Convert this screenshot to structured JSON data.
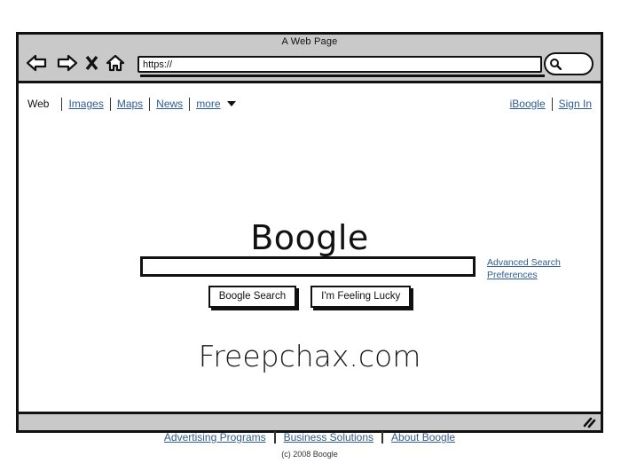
{
  "window": {
    "title": "A Web Page",
    "url_value": "https://",
    "url_placeholder": "https://",
    "toolbar_search_value": "",
    "icons": {
      "back": "back-arrow-icon",
      "forward": "forward-arrow-icon",
      "stop": "stop-x-icon",
      "home": "home-icon",
      "search": "magnifier-icon",
      "resize": "resize-grip-icon"
    }
  },
  "topnav": {
    "current": "Web",
    "links": [
      "Images",
      "Maps",
      "News",
      "more"
    ],
    "account_links": [
      "iBoogle",
      "Sign In"
    ]
  },
  "main": {
    "logo": "Boogle",
    "search_value": "",
    "search_placeholder": "",
    "side_links": [
      "Advanced Search",
      "Preferences"
    ],
    "buttons": [
      "Boogle Search",
      "I'm Feeling Lucky"
    ],
    "tagline": "Freepchax.com"
  },
  "footer": {
    "links": [
      "Advertising Programs",
      "Business Solutions",
      "About Boogle"
    ],
    "copyright": "(c) 2008 Boogle"
  },
  "colors": {
    "link": "#2f5c93",
    "ink": "#111111",
    "chrome": "#c9c9c9",
    "page": "#ffffff"
  }
}
